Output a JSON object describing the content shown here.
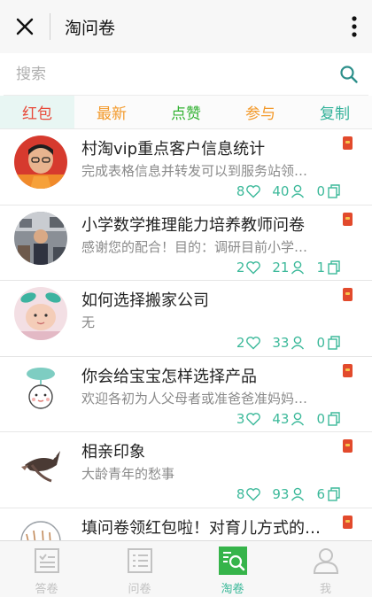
{
  "header": {
    "title": "淘问卷"
  },
  "search": {
    "placeholder": "搜索"
  },
  "tabs": [
    {
      "label": "红包",
      "color": "#e84a3a",
      "active": true
    },
    {
      "label": "最新",
      "color": "#f39a2b",
      "active": false
    },
    {
      "label": "点赞",
      "color": "#33b233",
      "active": false
    },
    {
      "label": "参与",
      "color": "#f39a2b",
      "active": false
    },
    {
      "label": "复制",
      "color": "#33b29a",
      "active": false
    }
  ],
  "items": [
    {
      "title": "村淘vip重点客户信息统计",
      "desc": "完成表格信息并转发可以到服务站领…",
      "likes": "8",
      "participants": "40",
      "copies": "0"
    },
    {
      "title": "小学数学推理能力培养教师问卷",
      "desc": "感谢您的配合！目的：调研目前小学…",
      "likes": "2",
      "participants": "21",
      "copies": "1"
    },
    {
      "title": "如何选择搬家公司",
      "desc": "无",
      "likes": "2",
      "participants": "33",
      "copies": "0"
    },
    {
      "title": "你会给宝宝怎样选择产品",
      "desc": "欢迎各初为人父母者或准爸爸准妈妈…",
      "likes": "3",
      "participants": "43",
      "copies": "0"
    },
    {
      "title": "相亲印象",
      "desc": "大龄青年的愁事",
      "likes": "8",
      "participants": "93",
      "copies": "6"
    },
    {
      "title": "填问卷领红包啦！对育儿方式的…",
      "desc": "",
      "likes": "",
      "participants": "",
      "copies": ""
    }
  ],
  "bottom_nav": [
    {
      "label": "答卷",
      "icon": "answer-list-icon",
      "active": false
    },
    {
      "label": "问卷",
      "icon": "questionnaire-list-icon",
      "active": false
    },
    {
      "label": "淘卷",
      "icon": "search-survey-icon",
      "active": true
    },
    {
      "label": "我",
      "icon": "person-icon",
      "active": false
    }
  ],
  "colors": {
    "accent": "#3cb99a",
    "red_badge": "#e24a2c"
  }
}
